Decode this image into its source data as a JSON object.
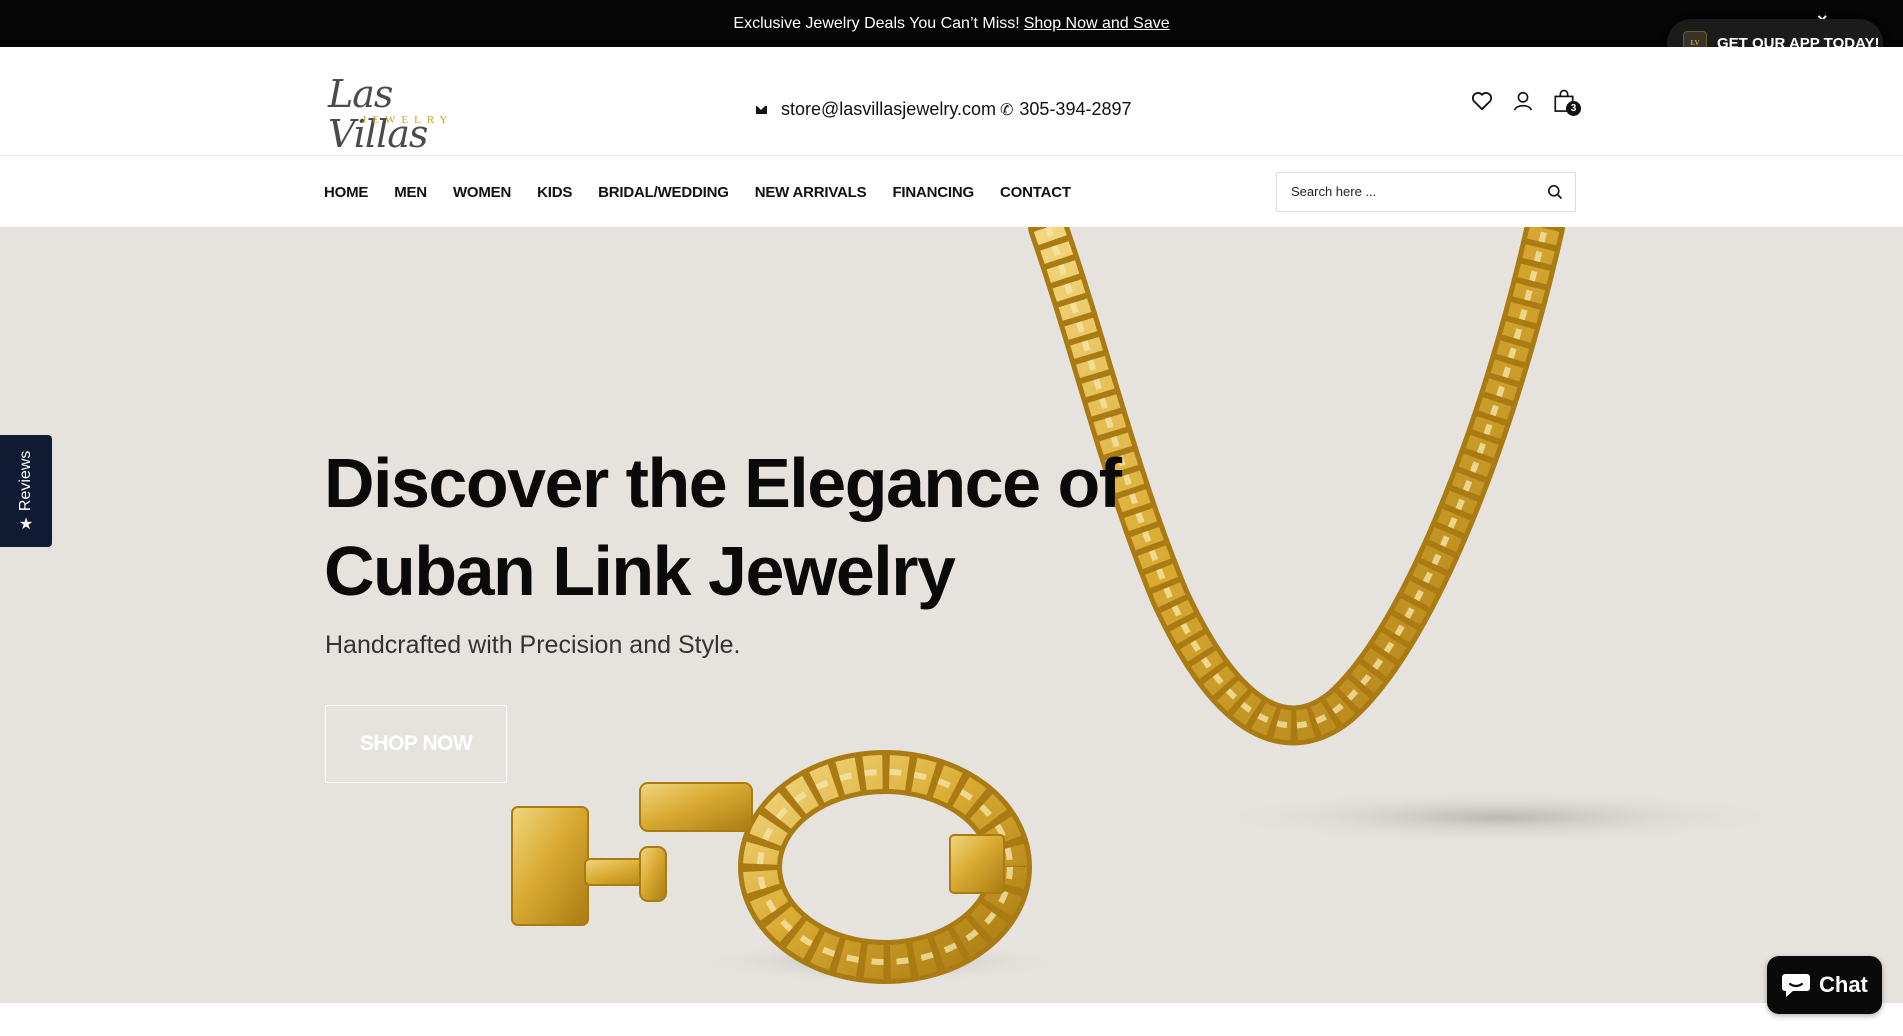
{
  "announcement": {
    "text": "Exclusive Jewelry Deals You Can’t Miss!",
    "link": "Shop Now and Save",
    "close": "×"
  },
  "app_banner": {
    "label": "GET OUR APP TODAY!"
  },
  "header": {
    "logo_script": "Las Villas",
    "logo_sub": "JEWELRY",
    "email": "store@lasvillasjewelry.com",
    "phone": "305-394-2897",
    "cart_count": "3"
  },
  "nav": {
    "items": [
      "HOME",
      "MEN",
      "WOMEN",
      "KIDS",
      "BRIDAL/WEDDING",
      "NEW ARRIVALS",
      "FINANCING",
      "CONTACT"
    ],
    "search_placeholder": "Search here ..."
  },
  "hero": {
    "title_line1": "Discover the Elegance of",
    "title_line2": "Cuban Link Jewelry",
    "subtitle": "Handcrafted with Precision and Style.",
    "cta": "SHOP NOW"
  },
  "reviews_tab": {
    "label": "Reviews"
  },
  "chat": {
    "label": "Chat"
  },
  "colors": {
    "gold": "#d4a62a",
    "hero_bg": "#e6e3df",
    "dark": "#050505",
    "reviews_bg": "#0f1b33"
  }
}
